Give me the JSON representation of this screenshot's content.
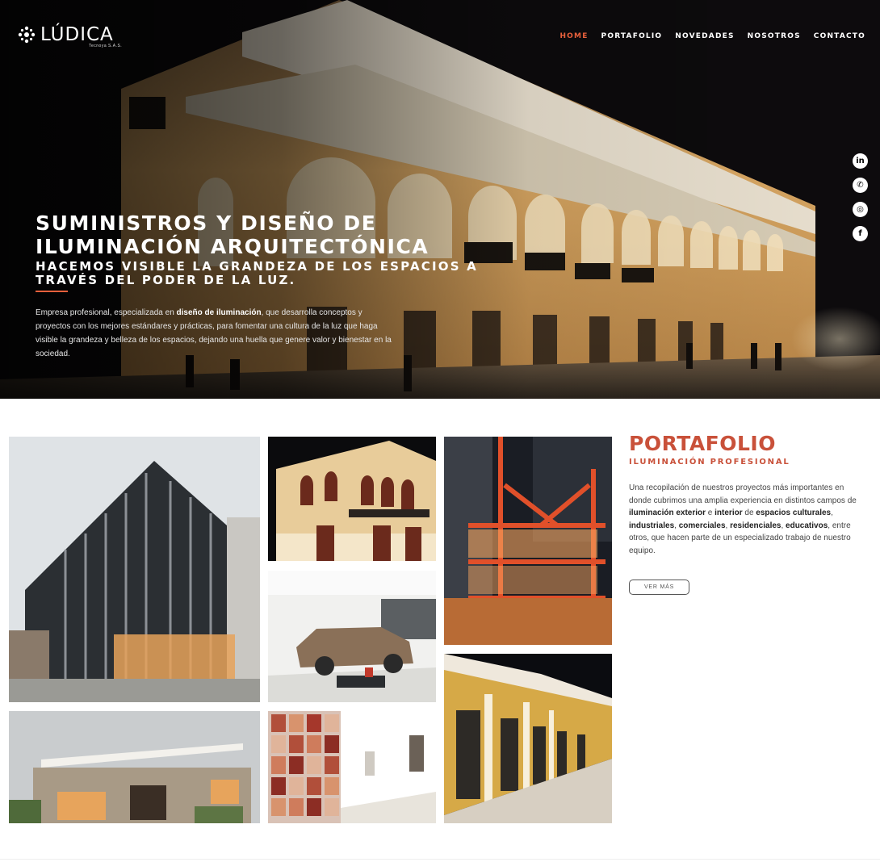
{
  "brand": {
    "name": "LÚDICA",
    "tagline": "Tecnoya S.A.S."
  },
  "nav": {
    "items": [
      {
        "label": "HOME",
        "active": true
      },
      {
        "label": "PORTAFOLIO",
        "active": false
      },
      {
        "label": "NOVEDADES",
        "active": false
      },
      {
        "label": "NOSOTROS",
        "active": false
      },
      {
        "label": "CONTACTO",
        "active": false
      }
    ]
  },
  "social": [
    {
      "icon": "linkedin-icon",
      "glyph": "in"
    },
    {
      "icon": "phone-icon",
      "glyph": "✆"
    },
    {
      "icon": "instagram-icon",
      "glyph": "◎"
    },
    {
      "icon": "facebook-icon",
      "glyph": "f"
    }
  ],
  "hero": {
    "title": "SUMINISTROS Y DISEÑO DE ILUMINACIÓN ARQUITECTÓNICA",
    "subtitle": "HACEMOS VISIBLE LA GRANDEZA DE LOS ESPACIOS A TRAVÉS DEL PODER DE LA LUZ.",
    "paragraph_before": "Empresa profesional, especializada en ",
    "paragraph_bold": "diseño de iluminación",
    "paragraph_after": ", que desarrolla conceptos y proyectos con los mejores estándares y prácticas, para fomentar una cultura de la luz que haga visible la grandeza y belleza de los espacios, dejando una huella que genere valor y bienestar en la sociedad."
  },
  "portfolio": {
    "title": "PORTAFOLIO",
    "subtitle": "ILUMINACIÓN PROFESIONAL",
    "p1": "Una recopilación de nuestros proyectos más importantes en donde cubrimos una amplia experiencia en distintos campos de ",
    "b1": "iluminación exterior",
    "p2": " e ",
    "b2": "interior",
    "p3": " de ",
    "b3": "espacios culturales",
    "p4": ", ",
    "b4": "industriales",
    "p5": ", ",
    "b5": "comerciales",
    "p6": ", ",
    "b6": "residenciales",
    "p7": ", ",
    "b7": "educativos",
    "p8": ", entre otros, que hacen parte de un especializado trabajo de nuestro equipo.",
    "button": "VER MÁS"
  },
  "colors": {
    "accent": "#e8603c",
    "portfolio_red": "#c9513a"
  }
}
